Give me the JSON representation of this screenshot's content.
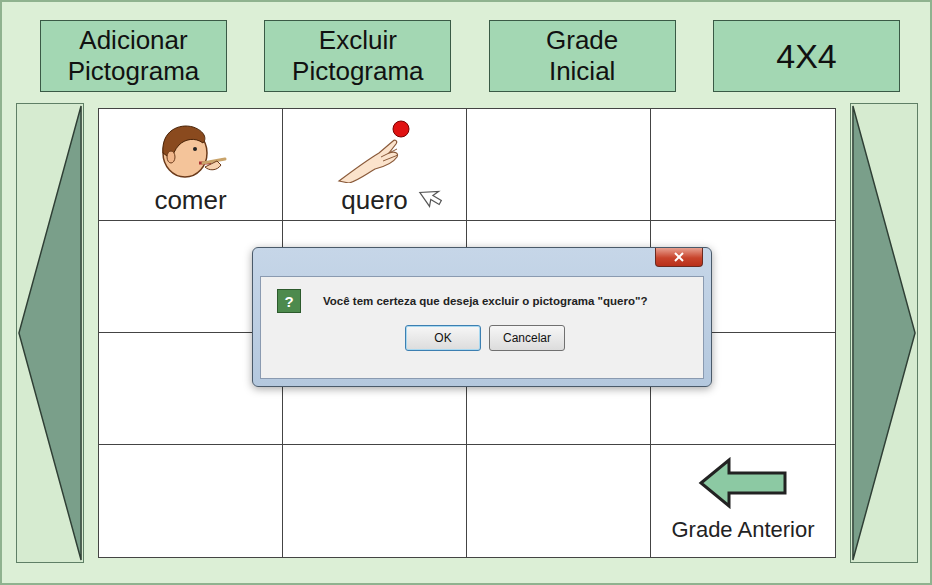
{
  "toolbar": [
    {
      "lines": [
        "Adicionar",
        "Pictograma"
      ]
    },
    {
      "lines": [
        "Excluir",
        "Pictograma"
      ]
    },
    {
      "lines": [
        "Grade",
        "Inicial"
      ]
    },
    {
      "lines": [
        "4X4"
      ]
    }
  ],
  "grid": {
    "cells": [
      {
        "kind": "pictogram",
        "label": "comer",
        "selected": false
      },
      {
        "kind": "pictogram",
        "label": "quero",
        "selected": true
      },
      {
        "kind": "empty"
      },
      {
        "kind": "empty"
      },
      {
        "kind": "empty"
      },
      {
        "kind": "empty"
      },
      {
        "kind": "empty"
      },
      {
        "kind": "empty"
      },
      {
        "kind": "empty"
      },
      {
        "kind": "empty"
      },
      {
        "kind": "empty"
      },
      {
        "kind": "empty"
      },
      {
        "kind": "empty"
      },
      {
        "kind": "empty"
      },
      {
        "kind": "empty"
      },
      {
        "kind": "back",
        "label": "Grade Anterior"
      }
    ]
  },
  "dialog": {
    "icon": "?",
    "message": "Você tem certeza que deseja excluir o pictograma \"quero\"?",
    "buttons": [
      {
        "label": "OK",
        "default": true
      },
      {
        "label": "Cancelar",
        "default": false
      }
    ]
  }
}
